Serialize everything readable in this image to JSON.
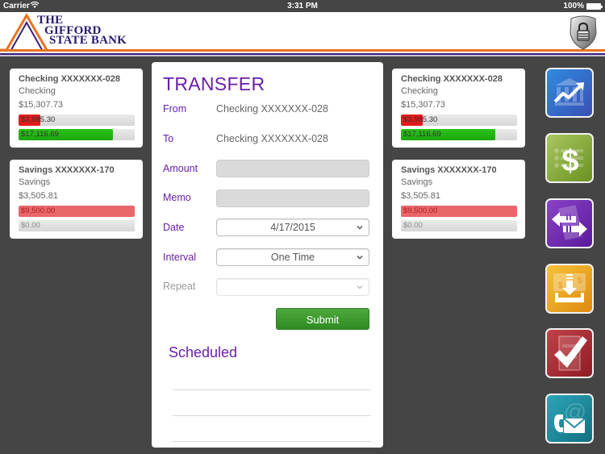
{
  "status_bar": {
    "carrier": "Carrier",
    "time": "3:31 PM",
    "battery": "100%"
  },
  "header": {
    "logo_lines": [
      "THE",
      "GIFFORD",
      "STATE BANK"
    ],
    "lock_icon": "lock-shield-icon"
  },
  "colors": {
    "accent_purple": "#6a1fa6",
    "brand_orange": "#e8741f",
    "brand_navy": "#2a1a6e",
    "submit_green": "#3c9a2f",
    "background": "#454545"
  },
  "accounts_left": [
    {
      "title": "Checking XXXXXXX-028",
      "type": "Checking",
      "balance": "$15,307.73",
      "bars": [
        {
          "label": "$3,985.30",
          "fill_fraction": 0.19,
          "color": "red"
        },
        {
          "label": "$17,116.69",
          "fill_fraction": 0.81,
          "color": "green"
        }
      ]
    },
    {
      "title": "Savings XXXXXXX-170",
      "type": "Savings",
      "balance": "$3,505.81",
      "bars": [
        {
          "label": "$9,500.00",
          "fill_fraction": 1.0,
          "color": "pink"
        },
        {
          "label": "$0.00",
          "fill_fraction": 0.0,
          "color": "none"
        }
      ]
    }
  ],
  "accounts_right": [
    {
      "title": "Checking XXXXXXX-028",
      "type": "Checking",
      "balance": "$15,307.73",
      "bars": [
        {
          "label": "$3,985.30",
          "fill_fraction": 0.19,
          "color": "red"
        },
        {
          "label": "$17,116.69",
          "fill_fraction": 0.81,
          "color": "green"
        }
      ]
    },
    {
      "title": "Savings XXXXXXX-170",
      "type": "Savings",
      "balance": "$3,505.81",
      "bars": [
        {
          "label": "$9,500.00",
          "fill_fraction": 1.0,
          "color": "pink"
        },
        {
          "label": "$0.00",
          "fill_fraction": 0.0,
          "color": "none"
        }
      ]
    }
  ],
  "transfer": {
    "title": "TRANSFER",
    "from_label": "From",
    "from_value": "Checking XXXXXXX-028",
    "to_label": "To",
    "to_value": "Checking XXXXXXX-028",
    "amount_label": "Amount",
    "amount_value": "",
    "memo_label": "Memo",
    "memo_value": "",
    "date_label": "Date",
    "date_value": "4/17/2015",
    "interval_label": "Interval",
    "interval_value": "One Time",
    "repeat_label": "Repeat",
    "repeat_value": "",
    "submit_label": "Submit",
    "scheduled_title": "Scheduled",
    "scheduled_items": [
      "",
      "",
      ""
    ]
  },
  "nav": [
    {
      "name": "accounts-nav-button",
      "icon": "bank-chart-icon",
      "color": "#3a6fc9"
    },
    {
      "name": "pay-bills-nav-button",
      "icon": "dollar-icon",
      "color": "#7ea234"
    },
    {
      "name": "transfer-nav-button",
      "icon": "transfer-arrows-icon",
      "color": "#6a28b0"
    },
    {
      "name": "deposit-nav-button",
      "icon": "deposit-download-icon",
      "color": "#e2a01c"
    },
    {
      "name": "approvals-nav-button",
      "icon": "checkmark-icon",
      "color": "#a7262e"
    },
    {
      "name": "contact-nav-button",
      "icon": "phone-mail-icon",
      "color": "#1f8ea0"
    }
  ]
}
